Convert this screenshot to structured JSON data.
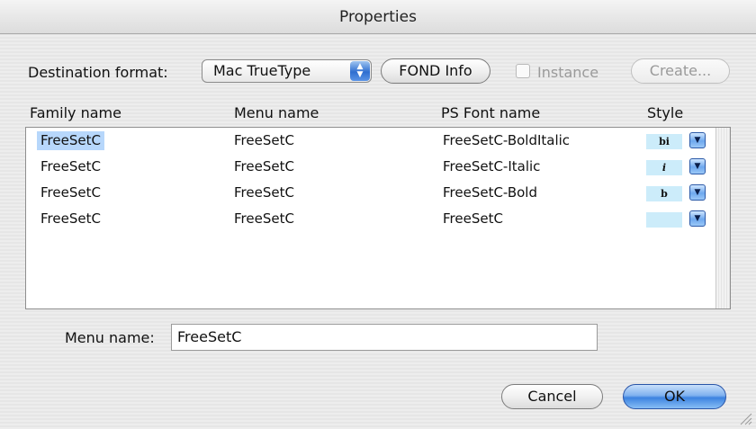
{
  "window": {
    "title": "Properties"
  },
  "toolbar": {
    "destination_label": "Destination format:",
    "format_value": "Mac TrueType",
    "fond_info_label": "FOND Info",
    "instance_label": "Instance",
    "create_label": "Create..."
  },
  "table": {
    "columns": [
      "Family name",
      "Menu name",
      "PS Font name",
      "Style"
    ],
    "rows": [
      {
        "family": "FreeSetC",
        "menu": "FreeSetC",
        "ps": "FreeSetC-BoldItalic",
        "style_glyph": "bi",
        "selected": true
      },
      {
        "family": "FreeSetC",
        "menu": "FreeSetC",
        "ps": "FreeSetC-Italic",
        "style_glyph": "i",
        "selected": false
      },
      {
        "family": "FreeSetC",
        "menu": "FreeSetC",
        "ps": "FreeSetC-Bold",
        "style_glyph": "b",
        "selected": false
      },
      {
        "family": "FreeSetC",
        "menu": "FreeSetC",
        "ps": "FreeSetC",
        "style_glyph": "",
        "selected": false
      }
    ]
  },
  "menu_field": {
    "label": "Menu name:",
    "value": "FreeSetC"
  },
  "buttons": {
    "cancel": "Cancel",
    "ok": "OK"
  },
  "colors": {
    "selection": "#b7d7fb",
    "style_swatch": "#ccecfa",
    "default_button": "#3d83e0"
  },
  "icons": {
    "popup_arrows": "up-down-arrows-icon",
    "style_menu": "down-triangle-icon",
    "resize": "resize-grip-icon"
  }
}
